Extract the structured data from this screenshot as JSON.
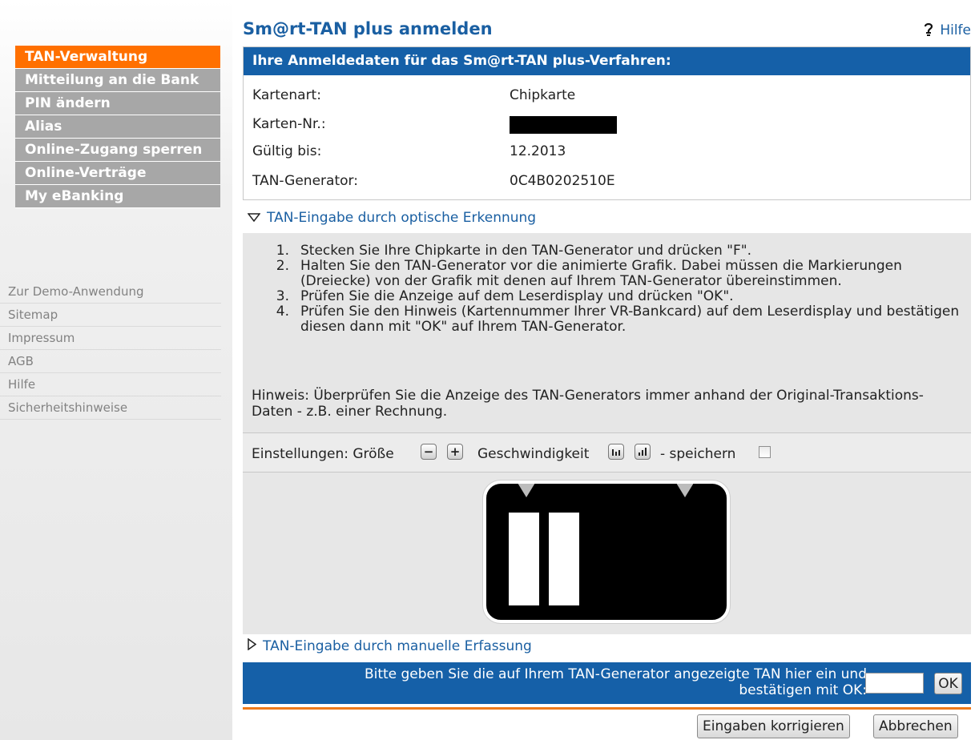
{
  "sidebar": {
    "nav": [
      {
        "label": "TAN-Verwaltung",
        "active": true
      },
      {
        "label": "Mitteilung an die Bank",
        "active": false
      },
      {
        "label": "PIN ändern",
        "active": false
      },
      {
        "label": "Alias",
        "active": false
      },
      {
        "label": "Online-Zugang sperren",
        "active": false
      },
      {
        "label": "Online-Verträge",
        "active": false
      },
      {
        "label": "My eBanking",
        "active": false
      }
    ],
    "links": [
      "Zur Demo-Anwendung",
      "Sitemap",
      "Impressum",
      "AGB",
      "Hilfe",
      "Sicherheitshinweise"
    ]
  },
  "header": {
    "title": "Sm@rt-TAN plus anmelden",
    "help_label": "Hilfe"
  },
  "login": {
    "header": "Ihre Anmeldedaten für das Sm@rt-TAN plus-Verfahren:",
    "rows": [
      {
        "label": "Kartenart:",
        "value": "Chipkarte"
      },
      {
        "label": "Karten-Nr.:",
        "value": ""
      },
      {
        "label": "Gültig bis:",
        "value": "12.2013"
      },
      {
        "label": "TAN-Generator:",
        "value": "0C4B0202510E"
      }
    ]
  },
  "optical": {
    "toggle_label": "TAN-Eingabe durch optische Erkennung",
    "steps": [
      {
        "num": "1.",
        "text": "Stecken Sie Ihre Chipkarte in den TAN-Generator und drücken \"F\"."
      },
      {
        "num": "2.",
        "text": "Halten Sie den TAN-Generator vor die animierte Grafik. Dabei müssen die Markierungen (Dreiecke) von der Grafik mit denen auf Ihrem TAN-Generator übereinstimmen."
      },
      {
        "num": "3.",
        "text": "Prüfen Sie die Anzeige auf dem Leserdisplay und drücken \"OK\"."
      },
      {
        "num": "4.",
        "text": "Prüfen Sie den Hinweis (Kartennummer Ihrer VR-Bankcard) auf dem Leserdisplay und bestätigen diesen dann mit \"OK\" auf Ihrem TAN-Generator."
      }
    ],
    "hint": "Hinweis: Überprüfen Sie die Anzeige des TAN-Generators immer anhand der Original-Transaktions-Daten - z.B. einer Rechnung."
  },
  "settings": {
    "label": "Einstellungen: Größe",
    "minus": "−",
    "plus": "+",
    "speed_label": "Geschwindigkeit",
    "save_label": "- speichern",
    "save_checked": false
  },
  "manual": {
    "toggle_label": "TAN-Eingabe durch manuelle Erfassung"
  },
  "tan_entry": {
    "line1": "Bitte geben Sie die auf Ihrem TAN-Generator angezeigte TAN hier ein und",
    "line2": "bestätigen mit OK:",
    "input_value": "",
    "ok_label": "OK"
  },
  "footer": {
    "correct_label": "Eingaben korrigieren",
    "cancel_label": "Abbrechen"
  },
  "colors": {
    "accent_orange": "#ff7000",
    "brand_blue": "#1560a8",
    "link_blue": "#1a5fa2",
    "nav_grey": "#a7a7a7"
  }
}
